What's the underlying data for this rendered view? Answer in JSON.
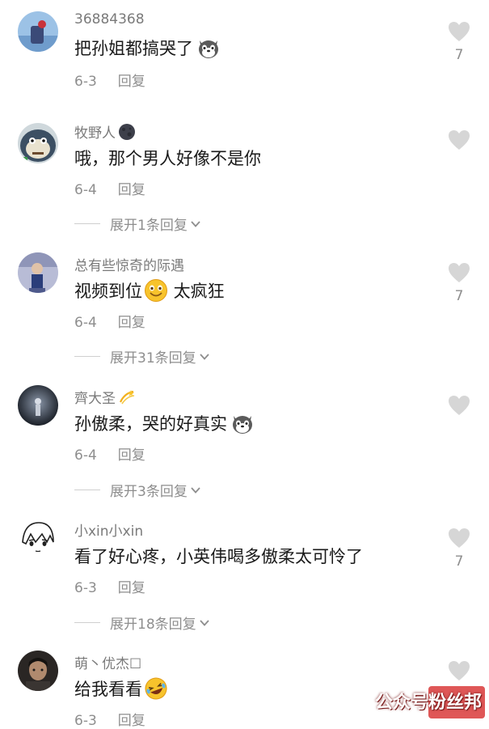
{
  "comments": [
    {
      "username": "36884368",
      "text": "把孙姐都搞哭了",
      "emoji": "husky-face-emoji",
      "date": "6-3",
      "reply": "回复",
      "likes": "7"
    },
    {
      "username": "牧野人",
      "username_emoji": "dark-moon-emoji",
      "text": "哦，那个男人好像不是你",
      "date": "6-4",
      "reply": "回复",
      "likes": "",
      "expand": "展开1条回复"
    },
    {
      "username": "总有些惊奇的际遇",
      "text_before": "视频到位",
      "emoji": "grinning-face-emoji",
      "text_after": " 太疯狂",
      "date": "6-4",
      "reply": "回复",
      "likes": "7",
      "expand": "展开31条回复"
    },
    {
      "username": "齊大圣",
      "username_emoji": "dizzy-emoji",
      "text": "孙傲柔，哭的好真实",
      "emoji": "husky-face-emoji",
      "date": "6-4",
      "reply": "回复",
      "likes": "",
      "expand": "展开3条回复"
    },
    {
      "username": "小xin小xin",
      "text": "看了好心疼，小英伟喝多傲柔太可怜了",
      "date": "6-3",
      "reply": "回复",
      "likes": "7",
      "expand": "展开18条回复"
    },
    {
      "username": "萌丶优杰☐",
      "text": "给我看看",
      "emoji": "rolling-laugh-emoji",
      "date": "6-3",
      "reply": "回复",
      "likes": ""
    }
  ],
  "watermark": "公众号粉丝邦",
  "colors": {
    "text": "#1a1a1a",
    "muted": "#8e8e8e",
    "like": "#d6d6d6",
    "watermark": "#d93a3a"
  }
}
